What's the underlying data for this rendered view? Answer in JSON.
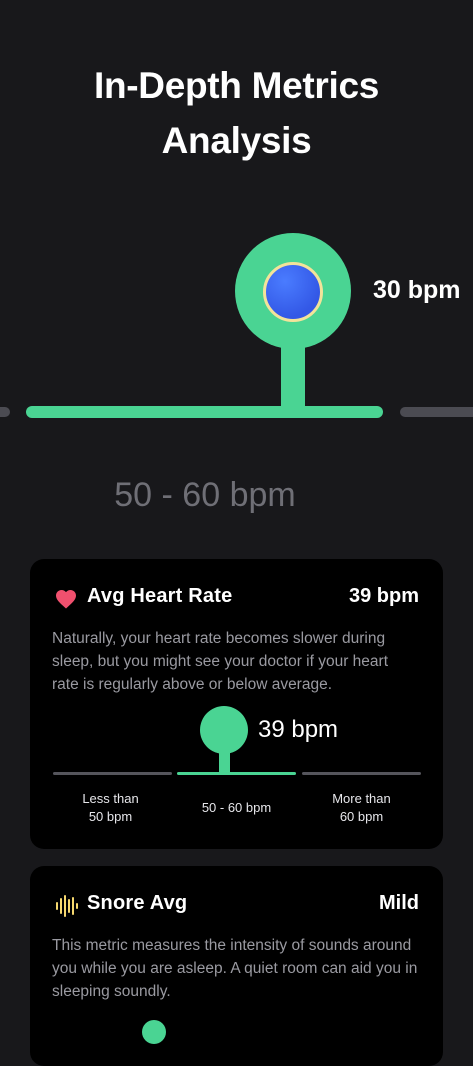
{
  "page": {
    "title_line1": "In-Depth Metrics",
    "title_line2": "Analysis"
  },
  "hero": {
    "value_label": "30 bpm",
    "range_label": "50 - 60 bpm",
    "accent_color": "#4ad493",
    "dot_color": "#3b66f0"
  },
  "heart_card": {
    "icon": "heart-icon",
    "icon_color": "#f0506e",
    "title": "Avg Heart Rate",
    "value": "39 bpm",
    "description": "Naturally, your heart rate becomes slower during sleep, but you might see your doctor if your heart rate is regularly above or below average.",
    "indicator_label": "39 bpm",
    "segments": [
      {
        "line1": "Less than",
        "line2": "50 bpm",
        "active": false
      },
      {
        "line1": "50 - 60 bpm",
        "line2": "",
        "active": true
      },
      {
        "line1": "More than",
        "line2": "60 bpm",
        "active": false
      }
    ]
  },
  "snore_card": {
    "icon": "sound-wave-icon",
    "icon_color": "#f5d76e",
    "title": "Snore Avg",
    "value": "Mild",
    "description": "This metric measures the intensity of sounds around you while you are asleep. A quiet room can aid you in sleeping soundly."
  }
}
